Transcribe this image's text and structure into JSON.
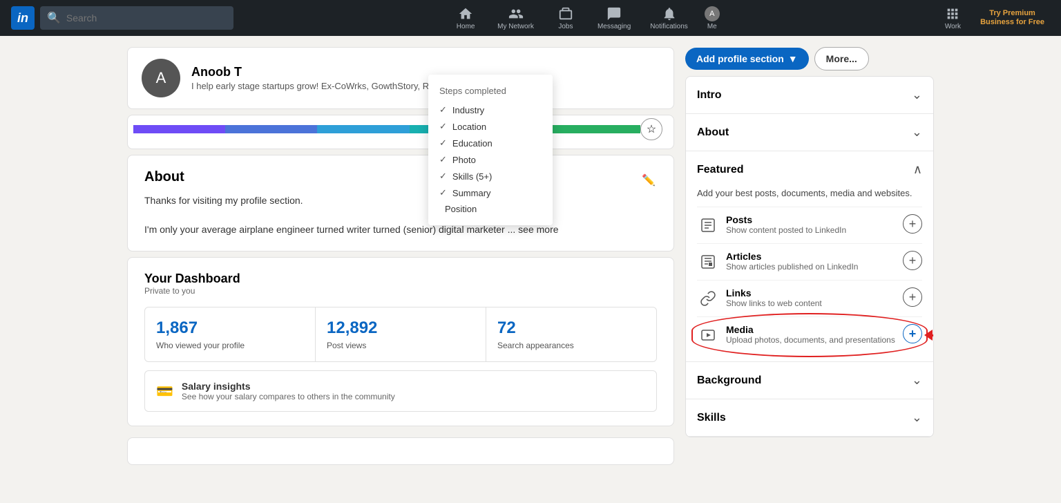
{
  "navbar": {
    "logo": "in",
    "search_placeholder": "Search",
    "nav_items": [
      {
        "id": "home",
        "label": "Home",
        "icon": "home"
      },
      {
        "id": "my-network",
        "label": "My Network",
        "icon": "people"
      },
      {
        "id": "jobs",
        "label": "Jobs",
        "icon": "briefcase"
      },
      {
        "id": "messaging",
        "label": "Messaging",
        "icon": "chat"
      },
      {
        "id": "notifications",
        "label": "Notifications",
        "icon": "bell"
      }
    ],
    "me_label": "Me",
    "work_label": "Work",
    "premium_line1": "Try Premium",
    "premium_line2": "Business for Free"
  },
  "profile": {
    "name": "Anoob T",
    "tagline": "I help early stage startups grow! Ex-CoWrks, GowthStory, Robert Bosch, Simplilearn"
  },
  "buttons": {
    "add_profile_section": "Add profile section",
    "more": "More..."
  },
  "about": {
    "title": "About",
    "line1": "Thanks for visiting my profile section.",
    "line2": "I'm only your average airplane engineer turned writer turned (senior) digital marketer ... see more"
  },
  "dashboard": {
    "title": "Your Dashboard",
    "subtitle": "Private to you",
    "stats": [
      {
        "num": "1,867",
        "label": "Who viewed your profile"
      },
      {
        "num": "12,892",
        "label": "Post views"
      },
      {
        "num": "72",
        "label": "Search appearances"
      }
    ],
    "salary_title": "Salary insights",
    "salary_sub": "See how your salary compares to others in the community"
  },
  "steps_dropdown": {
    "title": "Steps completed",
    "items": [
      {
        "label": "Industry",
        "checked": true
      },
      {
        "label": "Location",
        "checked": true
      },
      {
        "label": "Education",
        "checked": true
      },
      {
        "label": "Photo",
        "checked": true
      },
      {
        "label": "Skills (5+)",
        "checked": true
      },
      {
        "label": "Summary",
        "checked": true
      },
      {
        "label": "Position",
        "checked": false
      }
    ]
  },
  "sidebar": {
    "sections": [
      {
        "id": "intro",
        "title": "Intro",
        "expanded": false,
        "chevron": "down"
      },
      {
        "id": "about",
        "title": "About",
        "expanded": false,
        "chevron": "down"
      },
      {
        "id": "featured",
        "title": "Featured",
        "expanded": true,
        "chevron": "up",
        "description": "Add your best posts, documents, media and websites.",
        "items": [
          {
            "id": "posts",
            "title": "Posts",
            "subtitle": "Show content posted to LinkedIn",
            "icon": "post"
          },
          {
            "id": "articles",
            "title": "Articles",
            "subtitle": "Show articles published on LinkedIn",
            "icon": "article"
          },
          {
            "id": "links",
            "title": "Links",
            "subtitle": "Show links to web content",
            "icon": "link"
          },
          {
            "id": "media",
            "title": "Media",
            "subtitle": "Upload photos, documents, and presentations",
            "icon": "media",
            "highlighted": true
          }
        ]
      },
      {
        "id": "background",
        "title": "Background",
        "expanded": false,
        "chevron": "down"
      },
      {
        "id": "skills",
        "title": "Skills",
        "expanded": false,
        "chevron": "down"
      }
    ]
  },
  "colors": {
    "linkedin_blue": "#0a66c2",
    "nav_bg": "#1d2226",
    "arrow_red": "#e02020",
    "premium_gold": "#e7a33e"
  }
}
